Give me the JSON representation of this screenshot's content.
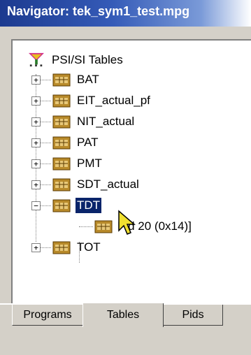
{
  "window": {
    "title": "Navigator: tek_sym1_test.mpg"
  },
  "tree": {
    "root": {
      "label": "PSI/SI Tables",
      "icon": "psi-tables-icon"
    },
    "items": [
      {
        "label": "BAT",
        "icon": "table-icon",
        "expander": "+"
      },
      {
        "label": "EIT_actual_pf",
        "icon": "table-icon",
        "expander": "+"
      },
      {
        "label": "NIT_actual",
        "icon": "table-icon",
        "expander": "+"
      },
      {
        "label": "PAT",
        "icon": "table-icon",
        "expander": "+"
      },
      {
        "label": "PMT",
        "icon": "table-icon",
        "expander": "+"
      },
      {
        "label": "SDT_actual",
        "icon": "table-icon",
        "expander": "+"
      },
      {
        "label": "TDT",
        "icon": "table-icon",
        "expander": "−",
        "selected": true
      },
      {
        "label": "Pid 20 (0x14)]",
        "icon": "table-icon"
      },
      {
        "label": "TOT",
        "icon": "table-icon",
        "expander": "+"
      }
    ]
  },
  "tabs": [
    {
      "label": "Programs"
    },
    {
      "label": "Tables",
      "active": true
    },
    {
      "label": "Pids"
    }
  ],
  "colors": {
    "selection": "#0a246a",
    "titlebar": "#1c3a8f",
    "chrome": "#d4d0c8"
  }
}
